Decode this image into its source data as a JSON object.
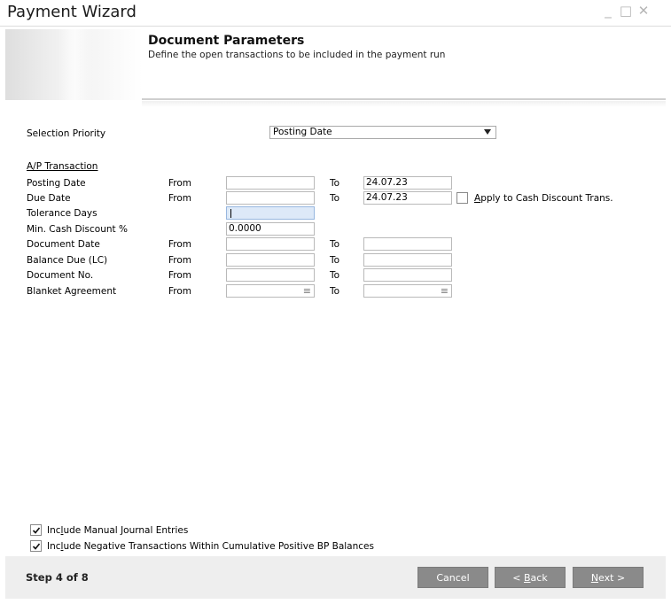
{
  "window": {
    "title": "Payment Wizard",
    "minimize_glyph": "_",
    "maximize_glyph": "□",
    "close_glyph": "✕"
  },
  "header": {
    "title": "Document Parameters",
    "subtitle": "Define the open transactions to be included in the payment run"
  },
  "selection_priority": {
    "label": "Selection Priority",
    "value": "Posting Date"
  },
  "ap_section_label": "A/P Transaction",
  "rows": {
    "posting_date": {
      "label": "Posting Date",
      "from_label": "From",
      "from_value": "",
      "to_label": "To",
      "to_value": "24.07.23"
    },
    "due_date": {
      "label": "Due Date",
      "from_label": "From",
      "from_value": "",
      "to_label": "To",
      "to_value": "24.07.23"
    },
    "tolerance_days": {
      "label": "Tolerance Days",
      "value": ""
    },
    "min_cash_discount": {
      "label": "Min. Cash Discount %",
      "value": "0.0000"
    },
    "document_date": {
      "label": "Document Date",
      "from_label": "From",
      "from_value": "",
      "to_label": "To",
      "to_value": ""
    },
    "balance_due": {
      "label": "Balance Due (LC)",
      "from_label": "From",
      "from_value": "",
      "to_label": "To",
      "to_value": ""
    },
    "document_no": {
      "label": "Document No.",
      "from_label": "From",
      "from_value": "",
      "to_label": "To",
      "to_value": ""
    },
    "blanket_agreement": {
      "label": "Blanket Agreement",
      "from_label": "From",
      "from_value": "",
      "to_label": "To",
      "to_value": "",
      "list_glyph": "≡"
    }
  },
  "apply_cash_discount": {
    "label_pre": "",
    "label_accel": "A",
    "label_post": "pply to Cash Discount Trans.",
    "checked": false
  },
  "include_manual_journal": {
    "label_pre": "Inc",
    "label_accel": "l",
    "label_post": "ude Manual Journal Entries",
    "checked": true
  },
  "include_negative": {
    "label_pre": "Inc",
    "label_accel": "l",
    "label_post": "ude Negative Transactions Within Cumulative Positive BP Balances",
    "checked": true
  },
  "footer": {
    "step": "Step 4 of 8",
    "cancel": "Cancel",
    "back_pre": "< ",
    "back_accel": "B",
    "back_post": "ack",
    "next_accel": "N",
    "next_post": "ext >"
  }
}
